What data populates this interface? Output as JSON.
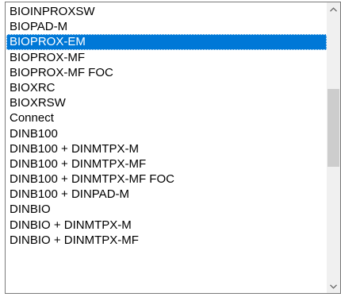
{
  "listbox": {
    "items": [
      {
        "label": "BIOINPROXSW"
      },
      {
        "label": "BIOPAD-M"
      },
      {
        "label": "BIOPROX-EM"
      },
      {
        "label": "BIOPROX-MF"
      },
      {
        "label": "BIOPROX-MF FOC"
      },
      {
        "label": "BIOXRC"
      },
      {
        "label": "BIOXRSW"
      },
      {
        "label": "Connect"
      },
      {
        "label": "DINB100"
      },
      {
        "label": "DINB100 + DINMTPX-M"
      },
      {
        "label": "DINB100 + DINMTPX-MF"
      },
      {
        "label": "DINB100 + DINMTPX-MF FOC"
      },
      {
        "label": "DINB100 + DINPAD-M"
      },
      {
        "label": "DINBIO"
      },
      {
        "label": "DINBIO + DINMTPX-M"
      },
      {
        "label": "DINBIO + DINMTPX-MF"
      }
    ],
    "selected_label": "BIOPROX-EM"
  },
  "scrollbar": {
    "up_icon": "chevron-up-icon",
    "down_icon": "chevron-down-icon"
  },
  "colors": {
    "selection_bg": "#0078d7",
    "selection_text": "#ffffff",
    "scroll_track": "#f0f0f0",
    "scroll_thumb": "#cdcdcd",
    "border": "#7a7a7a"
  }
}
